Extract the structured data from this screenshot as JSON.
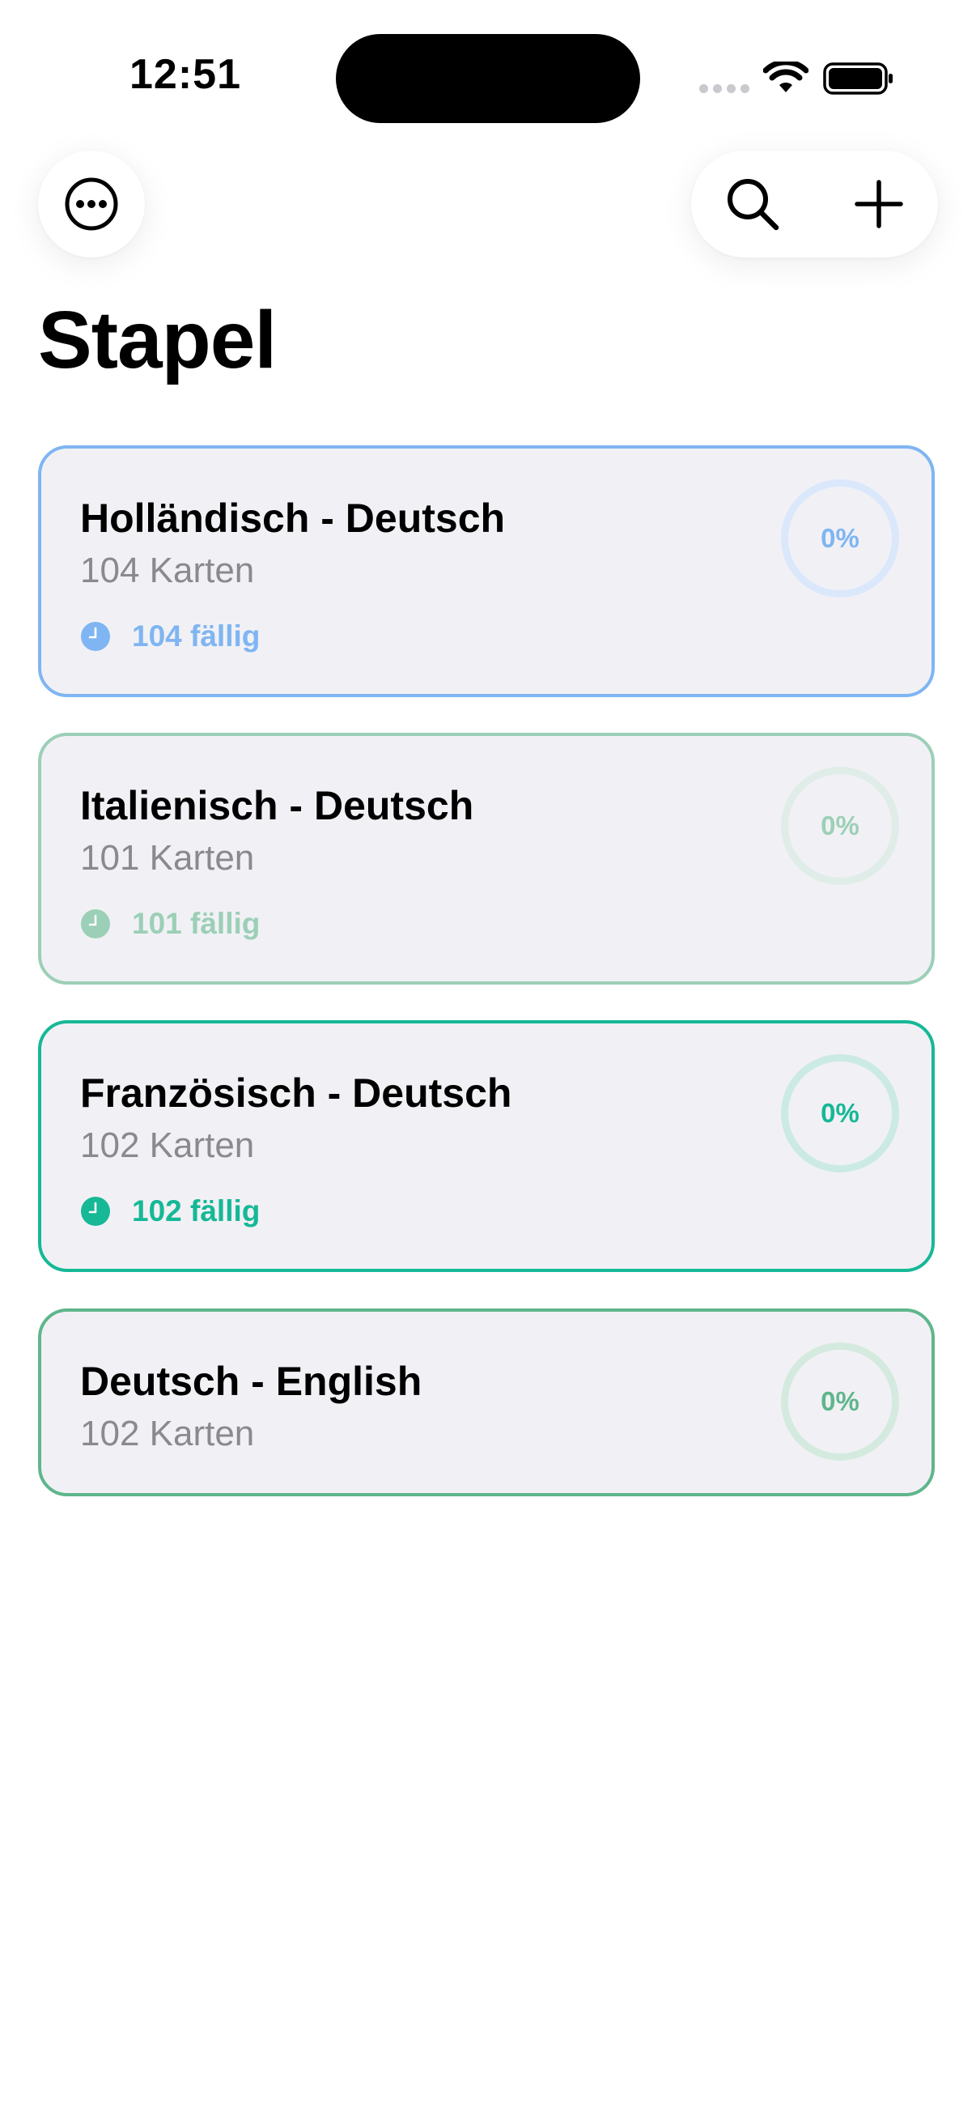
{
  "status_bar": {
    "time": "12:51"
  },
  "toolbar": {
    "more_icon": "ellipsis-circle-icon",
    "search_icon": "magnifier-icon",
    "add_icon": "plus-icon"
  },
  "page": {
    "title": "Stapel"
  },
  "decks": [
    {
      "title": "Holländisch - Deutsch",
      "count": "104 Karten",
      "due": "104 fällig",
      "progress": "0%",
      "progress_fraction": 0,
      "accent": "#7fb5f2",
      "ring_track": "#dbe8fb"
    },
    {
      "title": "Italienisch - Deutsch",
      "count": "101 Karten",
      "due": "101 fällig",
      "progress": "0%",
      "progress_fraction": 0,
      "accent": "#9ccfb7",
      "ring_track": "#e0ece8"
    },
    {
      "title": "Französisch - Deutsch",
      "count": "102 Karten",
      "due": "102 fällig",
      "progress": "0%",
      "progress_fraction": 0,
      "accent": "#16b896",
      "ring_track": "#cbeae3"
    },
    {
      "title": "Deutsch - English",
      "count": "102 Karten",
      "due": "",
      "progress": "0%",
      "progress_fraction": 0,
      "accent": "#5fb68c",
      "ring_track": "#d4eadf"
    }
  ]
}
